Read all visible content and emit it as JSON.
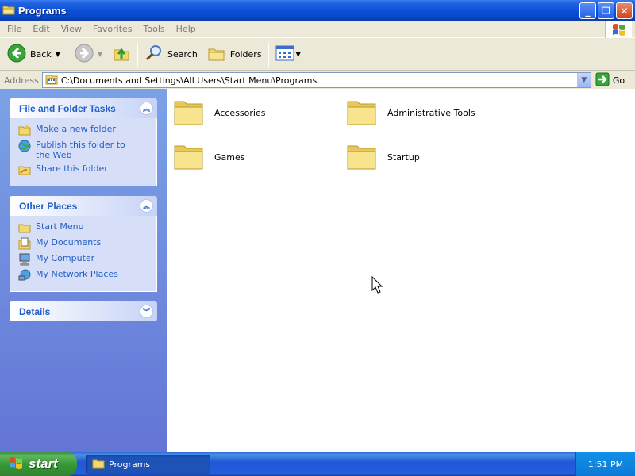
{
  "window": {
    "title": "Programs",
    "buttons": {
      "minimize": "_",
      "maximize": "❐",
      "close": "✕"
    }
  },
  "menu": [
    "File",
    "Edit",
    "View",
    "Favorites",
    "Tools",
    "Help"
  ],
  "toolbar": {
    "back_label": "Back",
    "search_label": "Search",
    "folders_label": "Folders"
  },
  "address": {
    "label": "Address",
    "path": "C:\\Documents and Settings\\All Users\\Start Menu\\Programs",
    "go_label": "Go"
  },
  "taskpane": {
    "file_tasks": {
      "title": "File and Folder Tasks",
      "items": [
        "Make a new folder",
        "Publish this folder to the Web",
        "Share this folder"
      ]
    },
    "other_places": {
      "title": "Other Places",
      "items": [
        "Start Menu",
        "My Documents",
        "My Computer",
        "My Network Places"
      ]
    },
    "details": {
      "title": "Details"
    }
  },
  "folders": [
    "Accessories",
    "Administrative Tools",
    "Games",
    "Startup"
  ],
  "taskbar": {
    "start_label": "start",
    "task_label": "Programs",
    "clock": "1:51 PM"
  },
  "colors": {
    "titlebar": "#0a4fd8",
    "taskpane_link": "#215dc6",
    "folder": "#f3d86a"
  }
}
